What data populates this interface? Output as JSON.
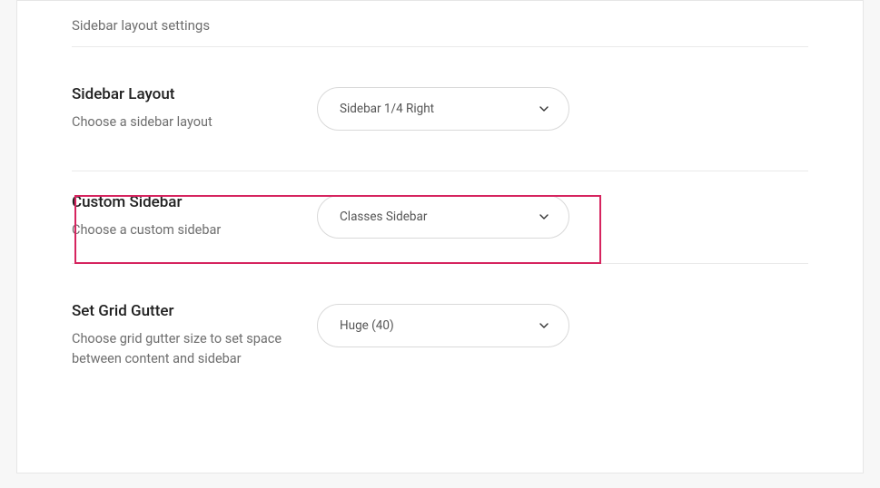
{
  "section_title": "Sidebar layout settings",
  "settings": [
    {
      "title": "Sidebar Layout",
      "desc": "Choose a sidebar layout",
      "selected": "Sidebar 1/4 Right"
    },
    {
      "title": "Custom Sidebar",
      "desc": "Choose a custom sidebar",
      "selected": "Classes Sidebar"
    },
    {
      "title": "Set Grid Gutter",
      "desc": "Choose grid gutter size to set space between content and sidebar",
      "selected": "Huge (40)"
    }
  ]
}
